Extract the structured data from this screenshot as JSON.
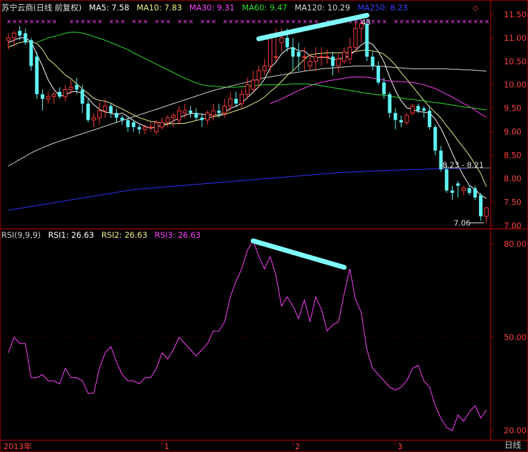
{
  "header": {
    "title": "苏宁云商(日线 前复权)",
    "ma5": "MA5: 7.58",
    "ma10": "MA10: 7.83",
    "ma30": "MA30: 9.31",
    "ma60": "MA60: 9.47",
    "ma120": "MA120: 10.29",
    "ma250": "MA250: 8.23"
  },
  "rsi_header": {
    "name": "RSI(9,9,9)",
    "rsi1": "RSI1: 26.63",
    "rsi2": "RSI2: 26.63",
    "rsi3": "RSI3: 26.63"
  },
  "footer": {
    "period": "日线"
  },
  "colors": {
    "up": "#ff3a3a",
    "down": "#5ff3f3",
    "ma5": "#ffffff",
    "ma10": "#f0f088",
    "ma30": "#ff40ff",
    "ma60": "#30e030",
    "ma120": "#d8d8d8",
    "ma250": "#3030ff",
    "rsi": "#ff40ff",
    "grid": "#8a0000",
    "annotation": "#7fffff"
  },
  "chart_data": [
    {
      "type": "candlestick",
      "title": "苏宁云商(日线 前复权)",
      "y_ticks": [
        11.5,
        11.0,
        10.5,
        10.0,
        9.5,
        9.0,
        8.5,
        8.0,
        7.5,
        7.0
      ],
      "y_tick_labels": [
        "11.50",
        "11.00",
        "10.50",
        "10.00",
        "9.50",
        "9.00",
        "8.50",
        "8.00",
        "7.50",
        "7.00"
      ],
      "ylim": [
        6.95,
        11.6
      ],
      "x_tick_labels": [
        "2013年",
        "1",
        "2",
        "3"
      ],
      "annotations": {
        "price_range": "8.23 - 8.21",
        "high_marker": "43",
        "low": "7.06"
      },
      "open": [
        10.95,
        11.0,
        11.15,
        11.1,
        10.95,
        10.6,
        9.8,
        9.7,
        9.75,
        9.85,
        9.75,
        9.9,
        10.0,
        9.9,
        9.6,
        9.25,
        9.3,
        9.45,
        9.55,
        9.4,
        9.3,
        9.25,
        9.2,
        9.1,
        9.05,
        9.1,
        9.0,
        9.1,
        9.2,
        9.3,
        9.25,
        9.4,
        9.45,
        9.4,
        9.3,
        9.25,
        9.35,
        9.45,
        9.4,
        9.55,
        9.7,
        9.6,
        9.8,
        9.9,
        10.1,
        10.3,
        10.4,
        10.6,
        10.9,
        11.0,
        10.8,
        10.7,
        10.6,
        10.4,
        10.5,
        10.6,
        10.6,
        10.6,
        10.4,
        10.5,
        10.55,
        10.8,
        11.2,
        11.3,
        10.6,
        10.4,
        10.05,
        9.8,
        9.4,
        9.25,
        9.2,
        9.4,
        9.55,
        9.5,
        9.45,
        9.1,
        8.6,
        8.2,
        7.75,
        7.9,
        7.75,
        7.8,
        7.8,
        7.65,
        7.2
      ],
      "high": [
        11.1,
        11.15,
        11.25,
        11.2,
        11.0,
        10.7,
        9.9,
        9.85,
        9.85,
        9.95,
        10.0,
        10.1,
        10.15,
        10.0,
        9.7,
        9.4,
        9.65,
        9.7,
        9.6,
        9.5,
        9.35,
        9.3,
        9.25,
        9.15,
        9.15,
        9.2,
        9.25,
        9.3,
        9.35,
        9.4,
        9.55,
        9.6,
        9.55,
        9.5,
        9.4,
        9.45,
        9.6,
        9.6,
        9.7,
        9.85,
        9.85,
        9.9,
        10.15,
        10.3,
        10.4,
        10.55,
        11.1,
        11.2,
        11.2,
        11.2,
        11.0,
        10.9,
        10.8,
        10.65,
        10.8,
        10.8,
        10.75,
        10.7,
        10.65,
        10.8,
        11.0,
        11.35,
        11.4,
        11.4,
        10.7,
        10.5,
        10.15,
        9.85,
        9.5,
        9.35,
        9.4,
        9.6,
        9.6,
        9.55,
        9.55,
        9.15,
        8.7,
        8.3,
        7.85,
        7.95,
        7.85,
        7.85,
        7.85,
        7.7,
        7.4
      ],
      "low": [
        10.75,
        10.85,
        10.95,
        10.85,
        10.3,
        9.7,
        9.45,
        9.6,
        9.6,
        9.7,
        9.65,
        9.8,
        9.8,
        9.4,
        9.2,
        9.1,
        9.15,
        9.3,
        9.3,
        9.2,
        9.15,
        9.0,
        9.0,
        8.95,
        8.95,
        9.0,
        8.95,
        9.05,
        9.1,
        9.1,
        9.15,
        9.3,
        9.3,
        9.25,
        9.1,
        9.15,
        9.25,
        9.3,
        9.3,
        9.45,
        9.55,
        9.5,
        9.7,
        9.85,
        9.95,
        10.2,
        10.25,
        10.5,
        10.7,
        10.7,
        10.3,
        10.3,
        10.3,
        10.3,
        10.3,
        10.4,
        10.45,
        10.2,
        10.25,
        10.45,
        10.45,
        10.7,
        10.9,
        10.5,
        10.3,
        10.0,
        9.7,
        9.3,
        9.05,
        9.1,
        9.15,
        9.35,
        9.4,
        9.3,
        9.05,
        8.5,
        8.15,
        7.7,
        7.55,
        7.6,
        7.65,
        7.65,
        7.55,
        7.1,
        7.06
      ],
      "close": [
        11.0,
        11.1,
        11.05,
        10.9,
        10.4,
        9.8,
        9.7,
        9.75,
        9.8,
        9.75,
        9.9,
        9.95,
        9.9,
        9.6,
        9.25,
        9.3,
        9.45,
        9.55,
        9.4,
        9.3,
        9.25,
        9.1,
        9.1,
        9.05,
        9.1,
        9.1,
        9.2,
        9.2,
        9.3,
        9.35,
        9.45,
        9.45,
        9.4,
        9.3,
        9.25,
        9.4,
        9.45,
        9.4,
        9.55,
        9.7,
        9.6,
        9.8,
        10.0,
        10.1,
        10.3,
        10.4,
        11.0,
        10.6,
        11.0,
        10.8,
        10.6,
        10.6,
        10.6,
        10.5,
        10.6,
        10.6,
        10.6,
        10.4,
        10.55,
        10.7,
        10.8,
        11.2,
        11.3,
        10.6,
        10.4,
        10.05,
        9.8,
        9.4,
        9.25,
        9.2,
        9.35,
        9.55,
        9.45,
        9.45,
        9.1,
        8.6,
        8.2,
        7.75,
        7.7,
        7.85,
        7.8,
        7.7,
        7.6,
        7.2,
        7.38
      ],
      "series": [
        {
          "name": "MA5",
          "values": [
            10.9,
            10.95,
            11.0,
            11.0,
            10.92,
            10.65,
            10.4,
            10.1,
            9.9,
            9.76,
            9.78,
            9.85,
            9.86,
            9.82,
            9.72,
            9.58,
            9.48,
            9.42,
            9.4,
            9.36,
            9.4,
            9.32,
            9.24,
            9.17,
            9.12,
            9.07,
            9.11,
            9.13,
            9.16,
            9.23,
            9.3,
            9.35,
            9.39,
            9.39,
            9.37,
            9.36,
            9.36,
            9.36,
            9.41,
            9.5,
            9.54,
            9.61,
            9.73,
            9.84,
            9.96,
            10.12,
            10.36,
            10.48,
            10.66,
            10.76,
            10.8,
            10.72,
            10.72,
            10.62,
            10.58,
            10.58,
            10.58,
            10.54,
            10.55,
            10.57,
            10.63,
            10.73,
            10.85,
            10.92,
            10.86,
            10.71,
            10.49,
            10.16,
            9.88,
            9.66,
            9.51,
            9.48,
            9.43,
            9.42,
            9.4,
            9.27,
            9.07,
            8.82,
            8.54,
            8.28,
            8.06,
            7.86,
            7.77,
            7.65,
            7.58
          ]
        },
        {
          "name": "MA10",
          "values": [
            10.8,
            10.85,
            10.9,
            10.92,
            10.92,
            10.88,
            10.75,
            10.55,
            10.45,
            10.33,
            10.21,
            10.13,
            10.02,
            9.91,
            9.82,
            9.71,
            9.67,
            9.65,
            9.61,
            9.54,
            9.49,
            9.42,
            9.36,
            9.3,
            9.26,
            9.22,
            9.21,
            9.18,
            9.17,
            9.17,
            9.18,
            9.18,
            9.21,
            9.24,
            9.27,
            9.3,
            9.32,
            9.34,
            9.37,
            9.41,
            9.45,
            9.49,
            9.54,
            9.6,
            9.66,
            9.74,
            9.85,
            9.95,
            10.07,
            10.2,
            10.3,
            10.42,
            10.54,
            10.64,
            10.66,
            10.67,
            10.68,
            10.68,
            10.68,
            10.68,
            10.69,
            10.71,
            10.73,
            10.74,
            10.72,
            10.7,
            10.65,
            10.55,
            10.42,
            10.26,
            10.12,
            9.97,
            9.82,
            9.67,
            9.53,
            9.41,
            9.29,
            9.13,
            8.98,
            8.81,
            8.66,
            8.5,
            8.31,
            8.11,
            7.83
          ]
        },
        {
          "name": "MA30",
          "values": [
            null,
            null,
            null,
            null,
            null,
            null,
            null,
            null,
            null,
            null,
            null,
            null,
            null,
            null,
            null,
            null,
            null,
            null,
            null,
            null,
            null,
            null,
            null,
            null,
            null,
            null,
            null,
            null,
            null,
            null,
            null,
            null,
            null,
            null,
            null,
            null,
            null,
            null,
            null,
            null,
            null,
            null,
            null,
            null,
            null,
            null,
            9.6,
            9.65,
            9.7,
            9.76,
            9.82,
            9.88,
            9.93,
            9.98,
            10.02,
            10.05,
            10.08,
            10.1,
            10.12,
            10.14,
            10.16,
            10.17,
            10.17,
            10.16,
            10.14,
            10.12,
            10.1,
            10.08,
            10.07,
            10.07,
            10.06,
            10.05,
            10.03,
            10.0,
            9.96,
            9.92,
            9.86,
            9.8,
            9.74,
            9.67,
            9.6,
            9.54,
            9.46,
            9.38,
            9.31
          ]
        },
        {
          "name": "MA60",
          "values": [
            null,
            null,
            null,
            null,
            null,
            10.9,
            10.95,
            11.0,
            11.03,
            11.06,
            11.1,
            11.12,
            11.12,
            11.1,
            11.07,
            11.03,
            10.99,
            10.95,
            10.9,
            10.85,
            10.8,
            10.75,
            10.68,
            10.62,
            10.56,
            10.5,
            10.44,
            10.38,
            10.32,
            10.26,
            10.2,
            10.14,
            10.09,
            10.04,
            10.0,
            9.98,
            9.97,
            9.96,
            9.95,
            9.95,
            9.95,
            9.96,
            9.97,
            9.98,
            9.99,
            10.0,
            10.0,
            10.0,
            10.0,
            10.01,
            10.02,
            10.02,
            10.02,
            10.01,
            10.0,
            9.98,
            9.96,
            9.94,
            9.92,
            9.9,
            9.88,
            9.86,
            9.84,
            9.82,
            9.8,
            9.79,
            9.78,
            9.76,
            9.74,
            9.72,
            9.7,
            9.69,
            9.67,
            9.66,
            9.64,
            9.62,
            9.61,
            9.59,
            9.57,
            9.55,
            9.53,
            9.52,
            9.5,
            9.48,
            9.47
          ]
        },
        {
          "name": "MA120",
          "values": [
            8.27,
            8.34,
            8.41,
            8.48,
            8.55,
            8.61,
            8.66,
            8.71,
            8.76,
            8.8,
            8.84,
            8.88,
            8.92,
            8.96,
            9.0,
            9.04,
            9.08,
            9.12,
            9.16,
            9.2,
            9.24,
            9.28,
            9.32,
            9.36,
            9.4,
            9.44,
            9.48,
            9.52,
            9.56,
            9.6,
            9.64,
            9.68,
            9.72,
            9.76,
            9.8,
            9.84,
            9.88,
            9.91,
            9.94,
            9.97,
            10.0,
            10.03,
            10.06,
            10.09,
            10.12,
            10.15,
            10.17,
            10.19,
            10.21,
            10.23,
            10.25,
            10.27,
            10.29,
            10.31,
            10.32,
            10.34,
            10.35,
            10.36,
            10.37,
            10.38,
            10.39,
            10.4,
            10.4,
            10.4,
            10.4,
            10.4,
            10.39,
            10.38,
            10.37,
            10.36,
            10.35,
            10.34,
            10.34,
            10.34,
            10.34,
            10.34,
            10.34,
            10.34,
            10.33,
            10.33,
            10.32,
            10.32,
            10.31,
            10.3,
            10.29
          ]
        },
        {
          "name": "MA250",
          "values": [
            7.33,
            7.35,
            7.37,
            7.39,
            7.41,
            7.43,
            7.45,
            7.47,
            7.49,
            7.51,
            7.53,
            7.55,
            7.57,
            7.59,
            7.61,
            7.63,
            7.65,
            7.67,
            7.69,
            7.71,
            7.73,
            7.75,
            7.77,
            7.78,
            7.79,
            7.8,
            7.81,
            7.82,
            7.83,
            7.84,
            7.85,
            7.86,
            7.87,
            7.88,
            7.89,
            7.9,
            7.91,
            7.92,
            7.93,
            7.94,
            7.95,
            7.96,
            7.97,
            7.98,
            7.99,
            8.0,
            8.01,
            8.02,
            8.03,
            8.04,
            8.05,
            8.06,
            8.07,
            8.08,
            8.09,
            8.1,
            8.11,
            8.12,
            8.13,
            8.14,
            8.14,
            8.15,
            8.15,
            8.16,
            8.16,
            8.17,
            8.17,
            8.18,
            8.18,
            8.19,
            8.19,
            8.2,
            8.2,
            8.2,
            8.21,
            8.21,
            8.21,
            8.22,
            8.22,
            8.22,
            8.22,
            8.23,
            8.23,
            8.23,
            8.23
          ]
        }
      ]
    },
    {
      "type": "line",
      "title": "RSI(9,9,9)",
      "y_ticks": [
        80.0,
        50.0,
        20.0
      ],
      "y_tick_labels": [
        "80.00",
        "50.00",
        "20.00"
      ],
      "ylim": [
        18,
        82
      ],
      "series": [
        {
          "name": "RSI1",
          "values": [
            45,
            50,
            48,
            48,
            37,
            37,
            38,
            36,
            36,
            35,
            40,
            37,
            37,
            36,
            32,
            32,
            40,
            45,
            47,
            42,
            38,
            36,
            36,
            35,
            37,
            37,
            40,
            45,
            43,
            46,
            50,
            48,
            46,
            44,
            46,
            48,
            52,
            52,
            55,
            63,
            68,
            72,
            78,
            81,
            76,
            72,
            76,
            70,
            60,
            63,
            60,
            56,
            62,
            55,
            63,
            59,
            52,
            54,
            55,
            64,
            72,
            62,
            58,
            46,
            40,
            38,
            36,
            34,
            33,
            34,
            36,
            40,
            41,
            36,
            34,
            28,
            24,
            21,
            20,
            25,
            23,
            26,
            28,
            24,
            26.63
          ]
        }
      ]
    }
  ]
}
